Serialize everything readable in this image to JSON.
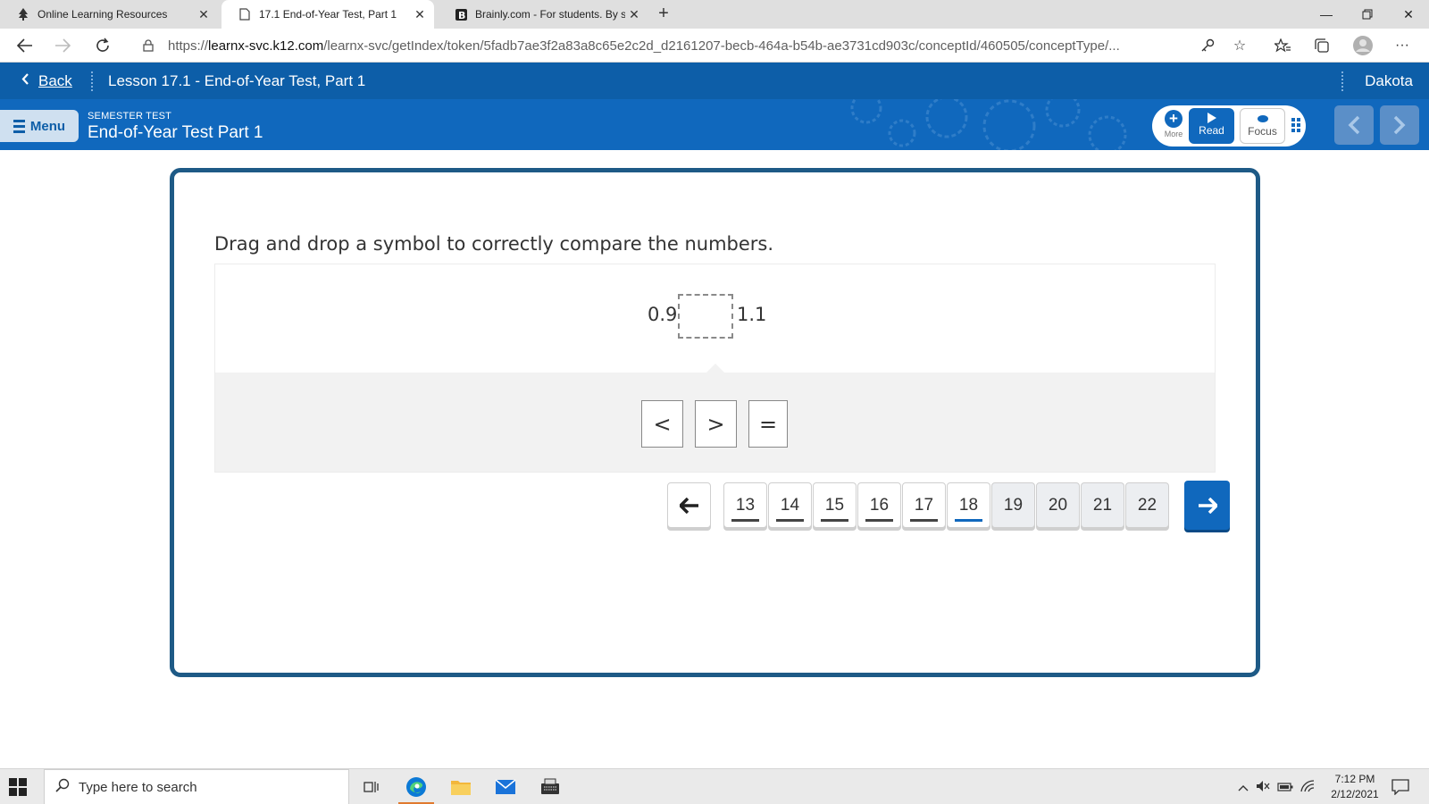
{
  "browser": {
    "tabs": [
      {
        "title": "Online Learning Resources",
        "active": false,
        "favicon": "tree-icon"
      },
      {
        "title": "17.1 End-of-Year Test, Part 1",
        "active": true,
        "favicon": "page-icon"
      },
      {
        "title": "Brainly.com - For students. By students.",
        "active": false,
        "favicon": "brainly-icon"
      }
    ],
    "url_prefix": "https://",
    "url_host": "learnx-svc.k12.com",
    "url_path": "/learnx-svc/getIndex/token/5fadb7ae3f2a83a8c65e2c2d_d2161207-becb-464a-b54b-ae3731cd903c/conceptId/460505/conceptType/..."
  },
  "header": {
    "back_label": "Back",
    "lesson_title": "Lesson 17.1 - End-of-Year Test, Part 1",
    "user_name": "Dakota",
    "menu_label": "Menu",
    "section_label": "SEMESTER TEST",
    "test_title": "End-of-Year Test Part 1",
    "more_label": "More",
    "read_label": "Read",
    "focus_label": "Focus"
  },
  "question": {
    "prompt": "Drag and drop a symbol to correctly compare the numbers.",
    "left_number": "0.9",
    "right_number": "1.1",
    "symbols": [
      "<",
      ">",
      "="
    ]
  },
  "navigator": {
    "prev_icon": "arrow-left-icon",
    "next_icon": "arrow-right-icon",
    "items": [
      {
        "label": "13",
        "state": "answered"
      },
      {
        "label": "14",
        "state": "answered"
      },
      {
        "label": "15",
        "state": "answered"
      },
      {
        "label": "16",
        "state": "answered"
      },
      {
        "label": "17",
        "state": "answered"
      },
      {
        "label": "18",
        "state": "current"
      },
      {
        "label": "19",
        "state": "unanswered"
      },
      {
        "label": "20",
        "state": "unanswered"
      },
      {
        "label": "21",
        "state": "unanswered"
      },
      {
        "label": "22",
        "state": "unanswered"
      }
    ]
  },
  "taskbar": {
    "search_placeholder": "Type here to search",
    "time": "7:12 PM",
    "date": "2/12/2021"
  },
  "colors": {
    "brand_blue": "#1068bd",
    "header_blue": "#0d5ea8",
    "card_border": "#1e5a86"
  }
}
